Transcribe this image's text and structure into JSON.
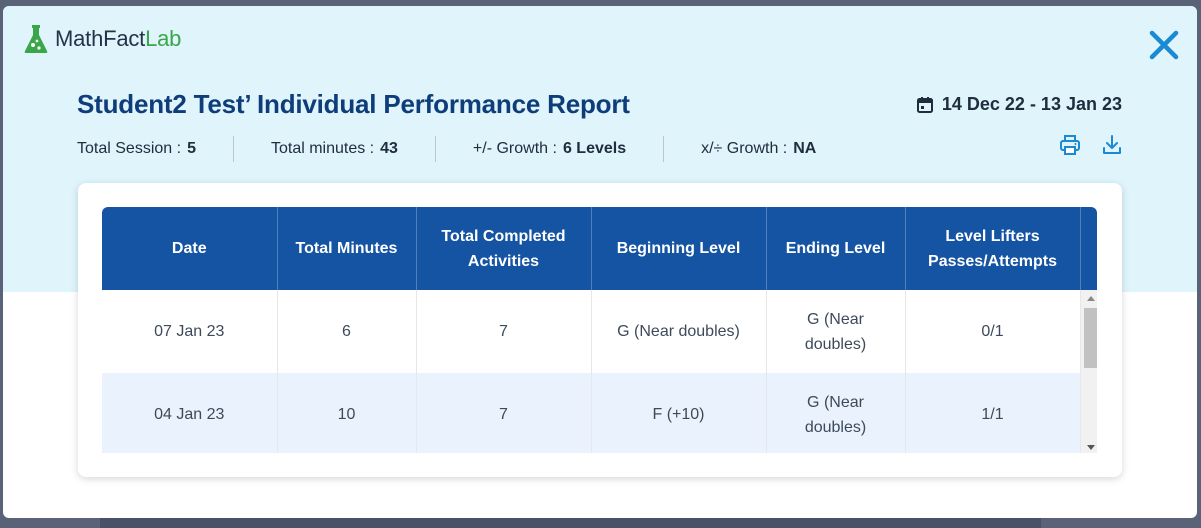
{
  "app": {
    "logo_math": "MathFact",
    "logo_lab": "Lab"
  },
  "report": {
    "title": "Student2 Test’ Individual Performance Report",
    "date_range": "14 Dec 22 - 13 Jan 23"
  },
  "stats": [
    {
      "label": "Total Session :",
      "value": "5"
    },
    {
      "label": "Total minutes :",
      "value": "43"
    },
    {
      "label": "+/- Growth :",
      "value": "6 Levels"
    },
    {
      "label": "x/÷ Growth :",
      "value": "NA"
    }
  ],
  "table": {
    "headers": [
      "Date",
      "Total Minutes",
      "Total Completed Activities",
      "Beginning Level",
      "Ending Level",
      "Level Lifters Passes/Attempts"
    ],
    "rows": [
      [
        "07 Jan 23",
        "6",
        "7",
        "G (Near doubles)",
        "G (Near doubles)",
        "0/1"
      ],
      [
        "04 Jan 23",
        "10",
        "7",
        "F (+10)",
        "G (Near doubles)",
        "1/1"
      ]
    ]
  },
  "colors": {
    "header_bg": "#1553a3",
    "title": "#0e3d7a",
    "accent": "#1a8ad4",
    "brand_green": "#3aa64a",
    "top_band": "#dff4fb"
  },
  "icons": {
    "logo": "flask-icon",
    "close": "close-icon",
    "calendar": "calendar-icon",
    "print": "print-icon",
    "download": "download-icon"
  }
}
